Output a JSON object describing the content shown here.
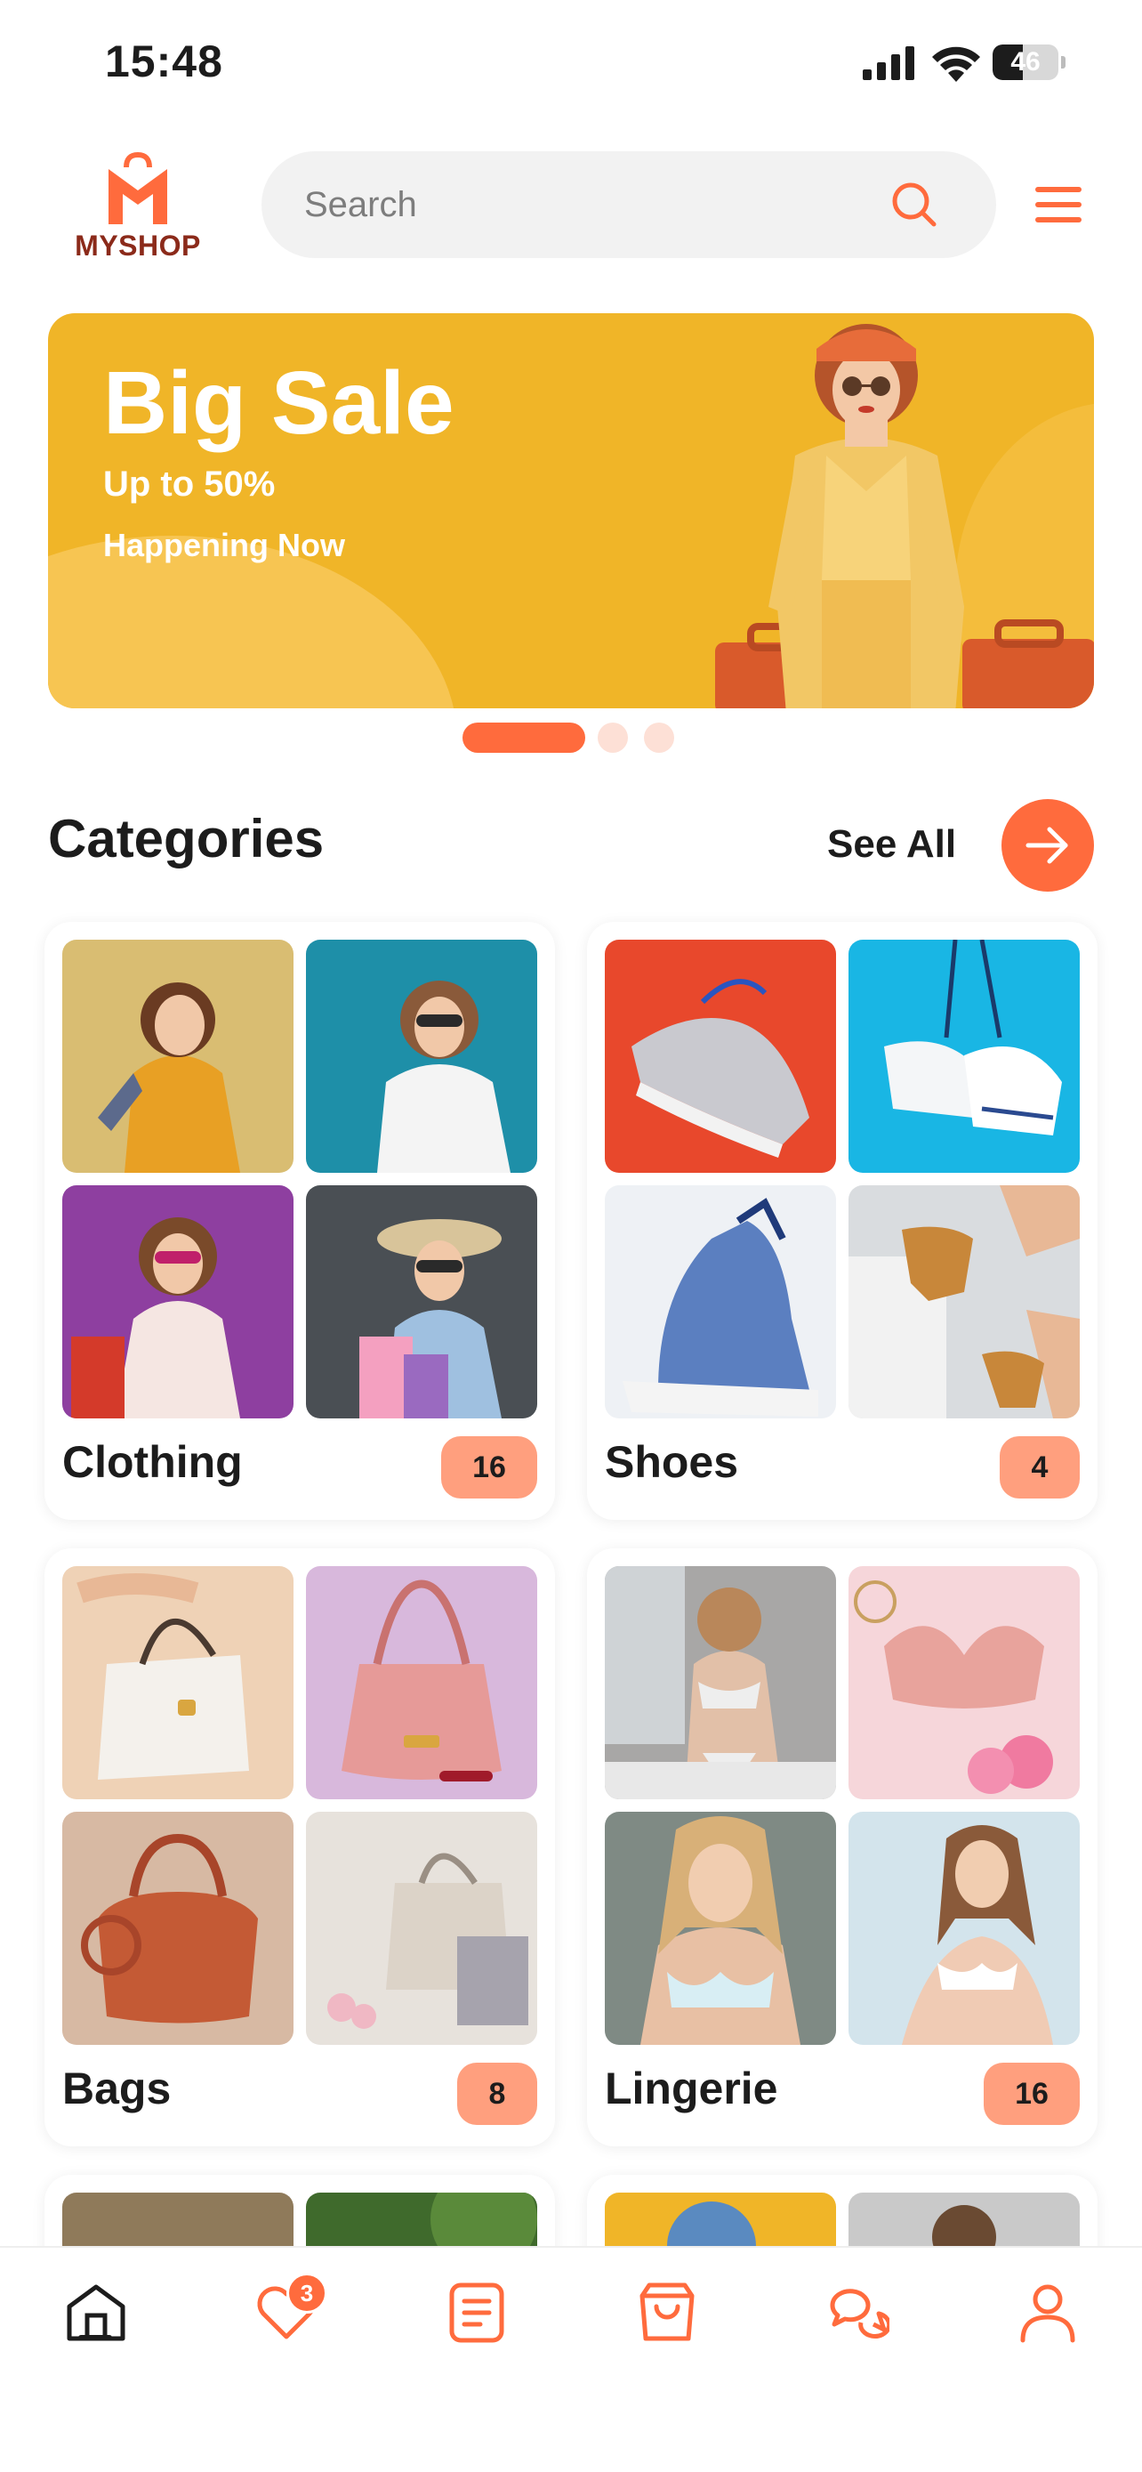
{
  "status_bar": {
    "time": "15:48",
    "battery": "46",
    "battery_level": 0.46
  },
  "header": {
    "logo_text": "MYSHOP",
    "search_placeholder": "Search"
  },
  "banner": {
    "title": "Big Sale",
    "subtitle": "Up to 50%",
    "tagline": "Happening Now",
    "active_slide": 1,
    "slide_count": 3
  },
  "categories": {
    "title": "Categories",
    "see_all": "See All",
    "items": [
      {
        "label": "Clothing",
        "count": "16"
      },
      {
        "label": "Shoes",
        "count": "4"
      },
      {
        "label": "Bags",
        "count": "8"
      },
      {
        "label": "Lingerie",
        "count": "16"
      }
    ]
  },
  "bottom_nav": {
    "items": [
      "home-icon",
      "heart-icon",
      "list-icon",
      "shopping-bag-icon",
      "chat-icon",
      "user-icon"
    ],
    "favorites_badge": "3",
    "active": "home-icon"
  },
  "colors": {
    "accent": "#ff6b3d",
    "banner": "#f0b528",
    "badge": "#ff9f7e",
    "logo_text": "#8b2a1a"
  }
}
